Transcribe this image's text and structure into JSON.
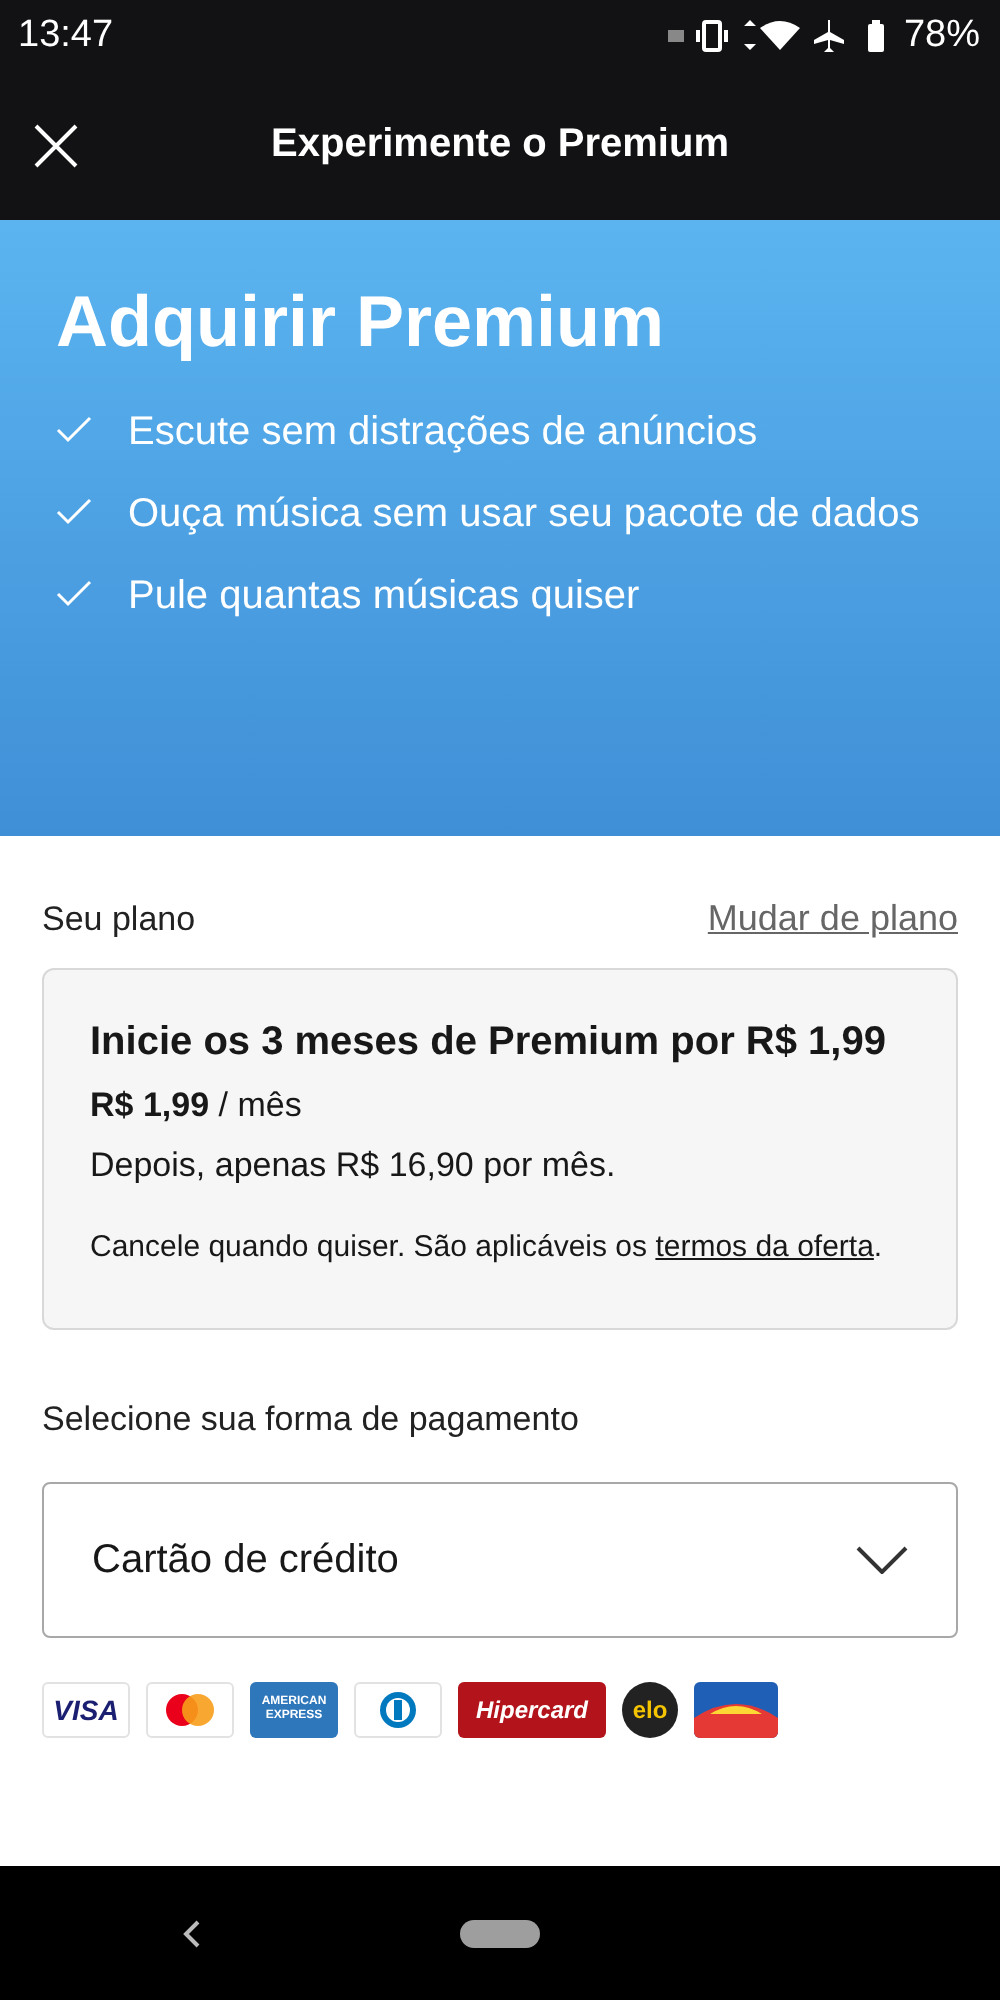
{
  "status_bar": {
    "time": "13:47",
    "battery": "78%"
  },
  "header": {
    "title": "Experimente o Premium"
  },
  "banner": {
    "title": "Adquirir Premium",
    "features": [
      "Escute sem distrações de anúncios",
      "Ouça música sem usar seu pacote de dados",
      "Pule quantas músicas quiser"
    ]
  },
  "plan": {
    "label": "Seu plano",
    "change_link": "Mudar de plano",
    "card": {
      "title": "Inicie os 3 meses de Premium por R$ 1,99",
      "price": "**R$ 1,99** / mês",
      "after": "Depois, apenas R$ 16,90 por mês.",
      "terms_text": "Cancele quando quiser. São aplicáveis os",
      "terms_link": "termos da oferta",
      "terms_end": "."
    }
  },
  "payment": {
    "label": "Selecione sua forma de pagamento",
    "method": "Cartão de crédito",
    "card_logos": [
      {
        "kind": "visa",
        "text": "VISA"
      },
      {
        "kind": "mastercard"
      },
      {
        "kind": "amex",
        "text": "AMERICAN EXPRESS"
      },
      {
        "kind": "diners"
      },
      {
        "kind": "hipercard",
        "text": "Hipercard"
      },
      {
        "kind": "elo",
        "text": "elo"
      },
      {
        "kind": "rainbow"
      }
    ]
  }
}
